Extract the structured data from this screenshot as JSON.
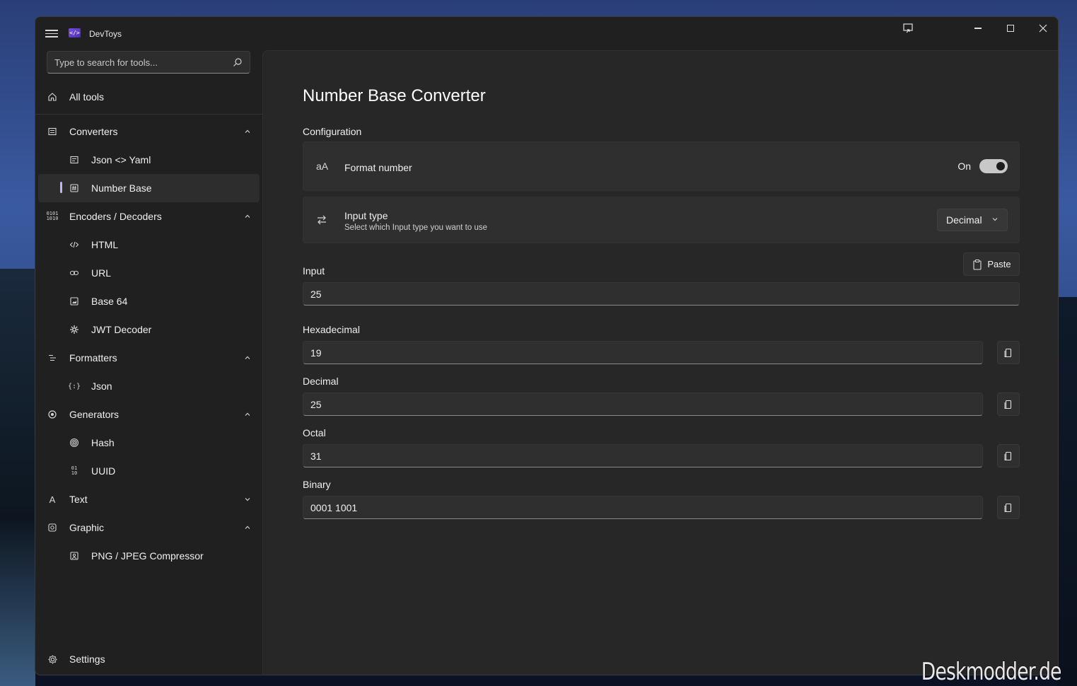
{
  "window": {
    "app_title": "DevToys"
  },
  "search": {
    "placeholder": "Type to search for tools..."
  },
  "nav": {
    "all_tools": "All tools",
    "converters": "Converters",
    "json_yaml": "Json <> Yaml",
    "number_base": "Number Base",
    "encoders_decoders": "Encoders / Decoders",
    "html": "HTML",
    "url": "URL",
    "base64": "Base 64",
    "jwt_decoder": "JWT Decoder",
    "formatters": "Formatters",
    "json": "Json",
    "generators": "Generators",
    "hash": "Hash",
    "uuid": "UUID",
    "text": "Text",
    "graphic": "Graphic",
    "png_jpeg": "PNG / JPEG Compressor",
    "settings": "Settings"
  },
  "main": {
    "title": "Number Base Converter",
    "configuration_label": "Configuration",
    "format_number": {
      "icon_text": "aA",
      "title": "Format number",
      "toggle_state": "On"
    },
    "input_type": {
      "title": "Input type",
      "subtitle": "Select which Input type you want to use",
      "selected": "Decimal"
    },
    "paste_label": "Paste",
    "input_label": "Input",
    "input_value": "25",
    "hex_label": "Hexadecimal",
    "hex_value": "19",
    "dec_label": "Decimal",
    "dec_value": "25",
    "oct_label": "Octal",
    "oct_value": "31",
    "bin_label": "Binary",
    "bin_value": "0001 1001"
  },
  "watermark": "Deskmodder.de",
  "colors": {
    "window_bg": "#202020",
    "content_bg": "#272727",
    "card_bg": "#2f2f2f",
    "accent": "#c5b3f0"
  }
}
